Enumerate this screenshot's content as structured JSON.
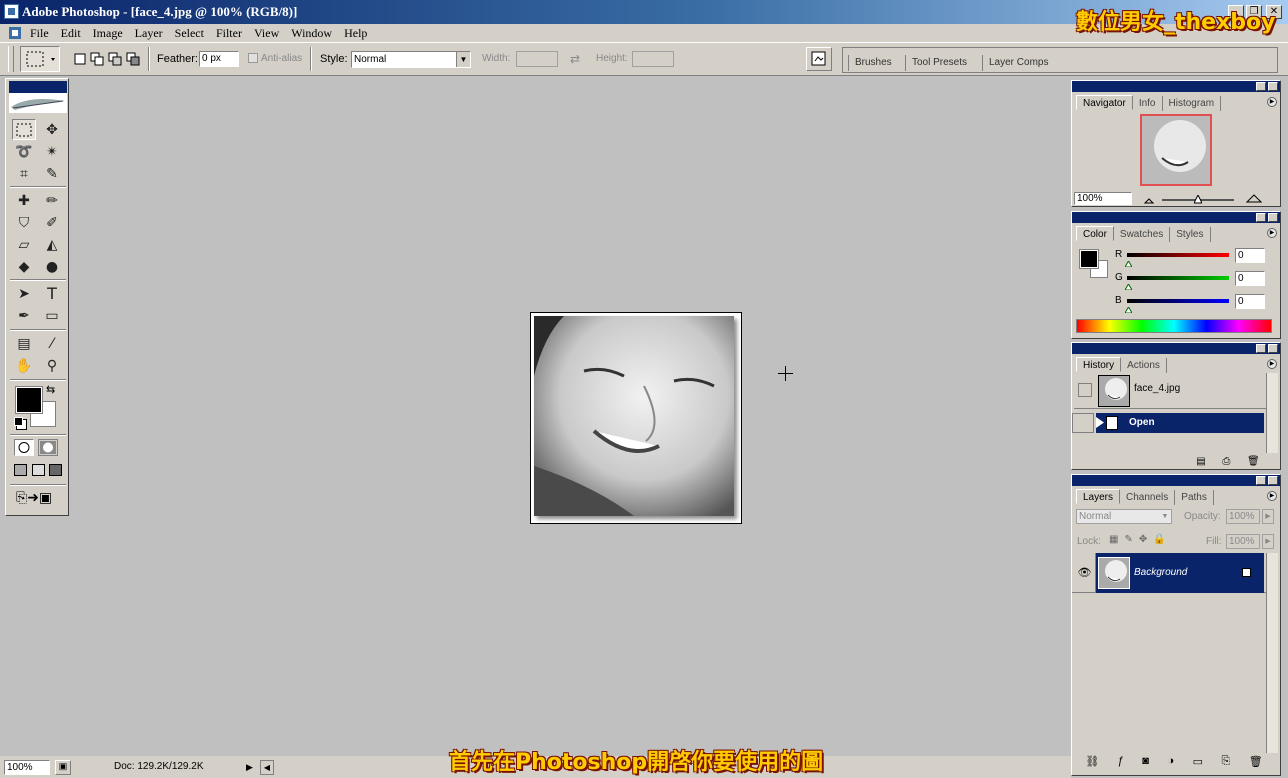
{
  "app": {
    "title": "Adobe Photoshop - [face_4.jpg @ 100% (RGB/8)]"
  },
  "window_buttons": {
    "minimize": "_",
    "restore": "❐",
    "close": "✕"
  },
  "menu": [
    "File",
    "Edit",
    "Image",
    "Layer",
    "Select",
    "Filter",
    "View",
    "Window",
    "Help"
  ],
  "options": {
    "feather_label": "Feather:",
    "feather_value": "0 px",
    "antialias_label": "Anti-alias",
    "style_label": "Style:",
    "style_value": "Normal",
    "width_label": "Width:",
    "height_label": "Height:"
  },
  "palette_well": {
    "tabs": [
      "Brushes",
      "Tool Presets",
      "Layer Comps"
    ]
  },
  "navigator": {
    "tabs": [
      "Navigator",
      "Info",
      "Histogram"
    ],
    "zoom": "100%"
  },
  "color": {
    "tabs": [
      "Color",
      "Swatches",
      "Styles"
    ],
    "r_label": "R",
    "g_label": "G",
    "b_label": "B",
    "r": "0",
    "g": "0",
    "b": "0"
  },
  "history": {
    "tabs": [
      "History",
      "Actions"
    ],
    "snapshot": "face_4.jpg",
    "step": "Open"
  },
  "layers": {
    "tabs": [
      "Layers",
      "Channels",
      "Paths"
    ],
    "blend_mode": "Normal",
    "opacity_label": "Opacity:",
    "opacity": "100%",
    "lock_label": "Lock:",
    "fill_label": "Fill:",
    "fill": "100%",
    "layer_name": "Background"
  },
  "status": {
    "zoom": "100%",
    "doc": "Doc: 129.2K/129.2K"
  },
  "overlay": {
    "brand": "數位男女_thexboy",
    "caption": "首先在Photoshop開啓你要使用的圖"
  },
  "colors": {
    "title_blue": "#0a246a",
    "panel_gray": "#d4d0c8",
    "canvas_gray": "#c0c0c0",
    "caption_yellow": "#ffcc00"
  }
}
